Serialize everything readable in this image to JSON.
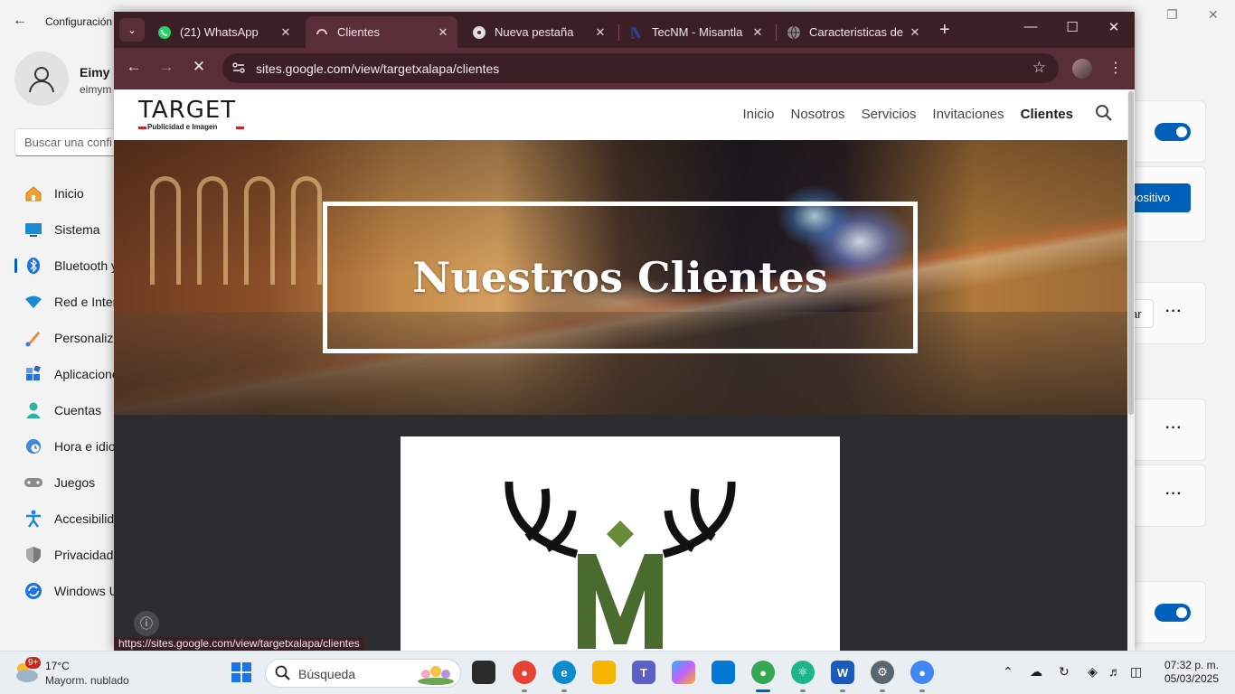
{
  "settings": {
    "title": "Configuración",
    "user": {
      "name": "Eimy M",
      "email": "eimym"
    },
    "search_placeholder": "Buscar una confi",
    "nav": [
      {
        "label": "Inicio",
        "icon": "home-icon"
      },
      {
        "label": "Sistema",
        "icon": "monitor-icon"
      },
      {
        "label": "Bluetooth y",
        "icon": "bluetooth-icon"
      },
      {
        "label": "Red e Inter",
        "icon": "wifi-icon"
      },
      {
        "label": "Personaliza",
        "icon": "brush-icon"
      },
      {
        "label": "Aplicacione",
        "icon": "apps-icon"
      },
      {
        "label": "Cuentas",
        "icon": "person-icon"
      },
      {
        "label": "Hora e idio",
        "icon": "clock-globe-icon"
      },
      {
        "label": "Juegos",
        "icon": "gamepad-icon"
      },
      {
        "label": "Accesibilid",
        "icon": "accessibility-icon"
      },
      {
        "label": "Privacidad",
        "icon": "shield-icon"
      },
      {
        "label": "Windows U",
        "icon": "update-icon"
      }
    ],
    "device_button": "positivo",
    "secondary_button": "ar",
    "more_label": "···",
    "accent_color": "#005fb8"
  },
  "browser": {
    "tabs": [
      {
        "label": "(21) WhatsApp",
        "icon": "whatsapp-icon"
      },
      {
        "label": "Clientes",
        "icon": "loading-icon"
      },
      {
        "label": "Nueva pestaña",
        "icon": "chrome-icon"
      },
      {
        "label": "TecNM - Misantla",
        "icon": "tecnm-icon"
      },
      {
        "label": "Caracteristicas de p",
        "icon": "globe-icon"
      }
    ],
    "active_tab": 1,
    "url": "sites.google.com/view/targetxalapa/clientes",
    "status_url": "https://sites.google.com/view/targetxalapa/clientes",
    "theme_color": "#5a2e36"
  },
  "site": {
    "logo_word": "TARGET",
    "logo_sub": "Publicidad e Imagen",
    "nav": [
      "Inicio",
      "Nosotros",
      "Servicios",
      "Invitaciones",
      "Clientes"
    ],
    "current_nav": "Clientes",
    "hero_title": "Nuestros Clientes",
    "client_logo": "M-deer-antlers-logo"
  },
  "taskbar": {
    "weather": {
      "temp": "17°C",
      "condition": "Mayorm. nublado",
      "badge": "9+"
    },
    "search_placeholder": "Búsqueda",
    "time": "07:32 p. m.",
    "date": "05/03/2025"
  }
}
